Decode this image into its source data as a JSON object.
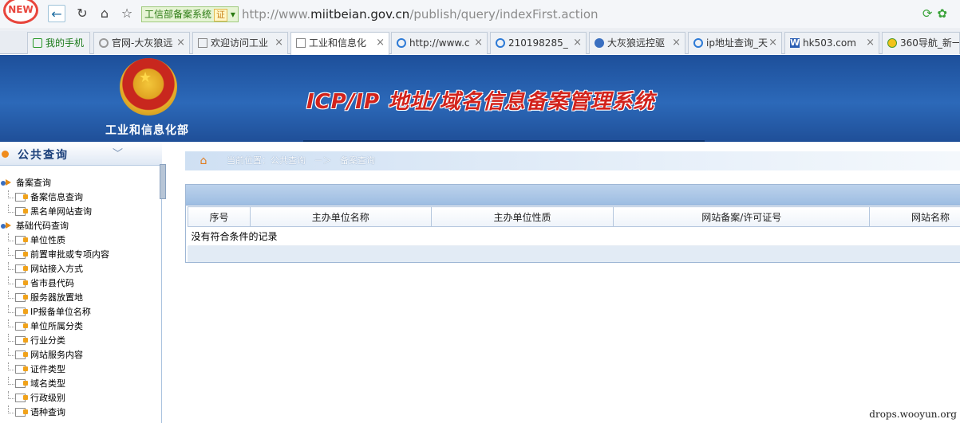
{
  "browser": {
    "new_badge": "NEW",
    "site_badge": "工信部备案系统",
    "cert_label": "证",
    "url_prefix": "http://www.",
    "url_domain": "miitbeian.gov.cn",
    "url_path": "/publish/query/indexFirst.action",
    "tabs": [
      {
        "label": "我的手机",
        "icon": "phone-icon",
        "closable": false
      },
      {
        "label": "官网-大灰狼远",
        "icon": "site-icon",
        "closable": true
      },
      {
        "label": "欢迎访问工业",
        "icon": "page-icon",
        "closable": true
      },
      {
        "label": "工业和信息化",
        "icon": "page-icon",
        "closable": true,
        "active": true
      },
      {
        "label": "http://www.c",
        "icon": "search-icon",
        "closable": true
      },
      {
        "label": "210198285_",
        "icon": "search-icon",
        "closable": true
      },
      {
        "label": "大灰狼远控驱",
        "icon": "globe-icon",
        "closable": true
      },
      {
        "label": "ip地址查询_天",
        "icon": "search-icon",
        "closable": true
      },
      {
        "label": "hk503.com",
        "icon": "word-icon",
        "closable": true
      },
      {
        "label": "360导航_新一",
        "icon": "nav360-icon",
        "closable": false
      }
    ]
  },
  "header": {
    "dept_name": "工业和信息化部",
    "system_title": "ICP/IP 地址/域名信息备案管理系统"
  },
  "sidebar": {
    "title": "公共查询",
    "groups": [
      {
        "label": "备案查询",
        "items": [
          "备案信息查询",
          "黑名单网站查询"
        ]
      },
      {
        "label": "基础代码查询",
        "items": [
          "单位性质",
          "前置审批或专项内容",
          "网站接入方式",
          "省市县代码",
          "服务器放置地",
          "IP报备单位名称",
          "单位所属分类",
          "行业分类",
          "网站服务内容",
          "证件类型",
          "域名类型",
          "行政级别",
          "语种查询"
        ]
      }
    ]
  },
  "breadcrumb": {
    "label": "当前位置：公共查询",
    "arrow": "－＞",
    "current": "备案查询"
  },
  "results": {
    "columns": [
      "序号",
      "主办单位名称",
      "主办单位性质",
      "网站备案/许可证号",
      "网站名称"
    ],
    "empty_message": "没有符合条件的记录"
  },
  "watermark": "drops.wooyun.org"
}
